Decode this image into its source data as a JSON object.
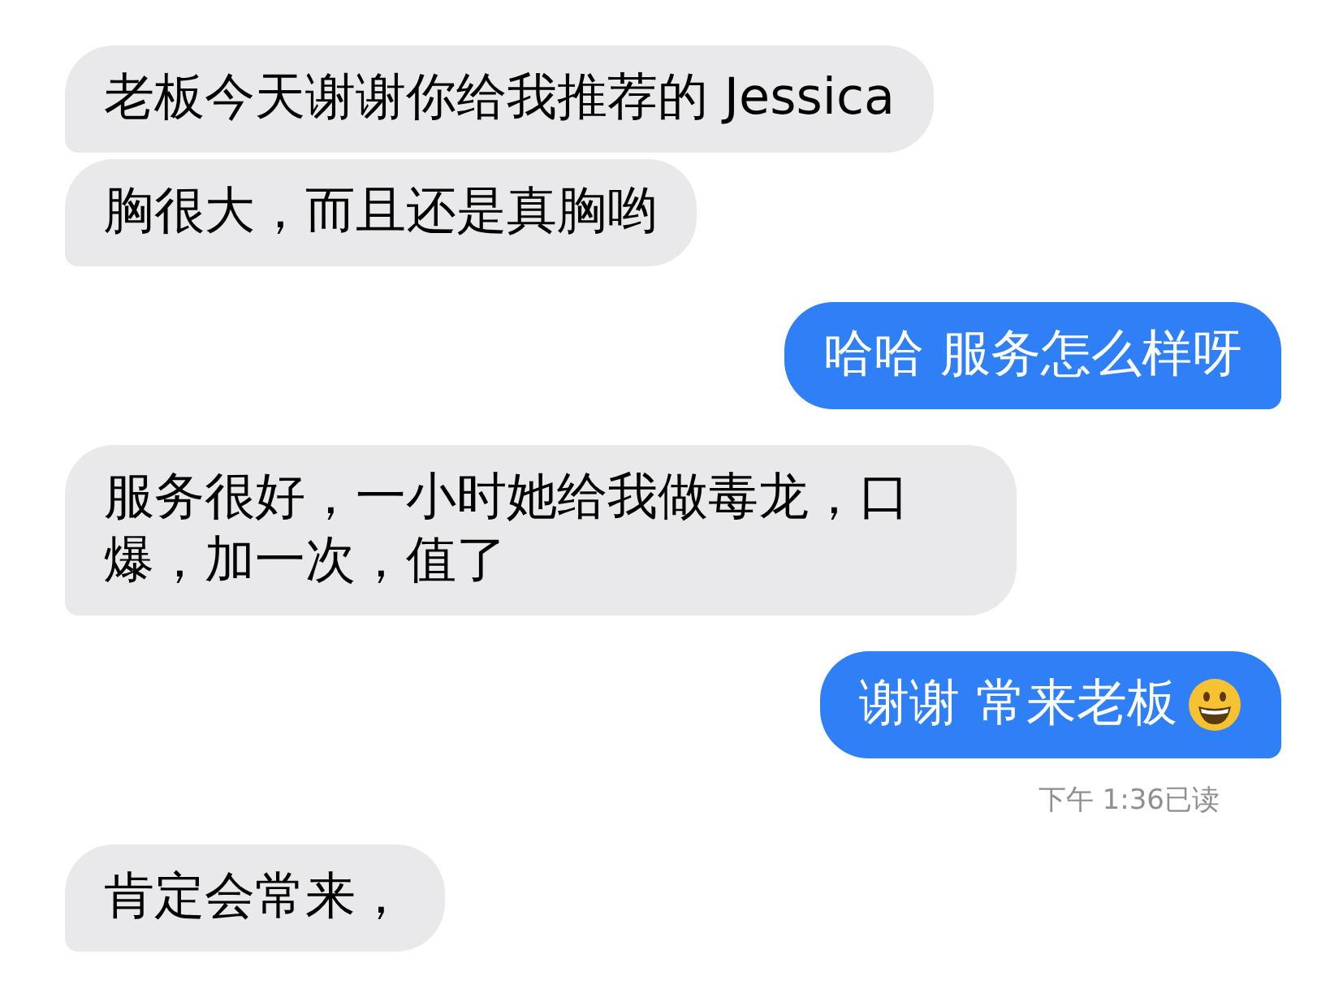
{
  "messages": [
    {
      "kind": "incoming",
      "text": "老板今天谢谢你给我推荐的 Jessica",
      "has_emoji": false
    },
    {
      "kind": "incoming",
      "text": "胸很大，而且还是真胸哟",
      "has_emoji": false
    },
    {
      "kind": "outgoing",
      "text": "哈哈 服务怎么样呀",
      "has_emoji": false
    },
    {
      "kind": "incoming",
      "text": "服务很好，一小时她给我做毒龙，口爆，加一次，值了",
      "has_emoji": false
    },
    {
      "kind": "outgoing",
      "text": "谢谢 常来老板",
      "has_emoji": true,
      "receipt": "下午 1:36已读"
    },
    {
      "kind": "incoming",
      "text": "肯定会常来，",
      "has_emoji": false
    }
  ]
}
